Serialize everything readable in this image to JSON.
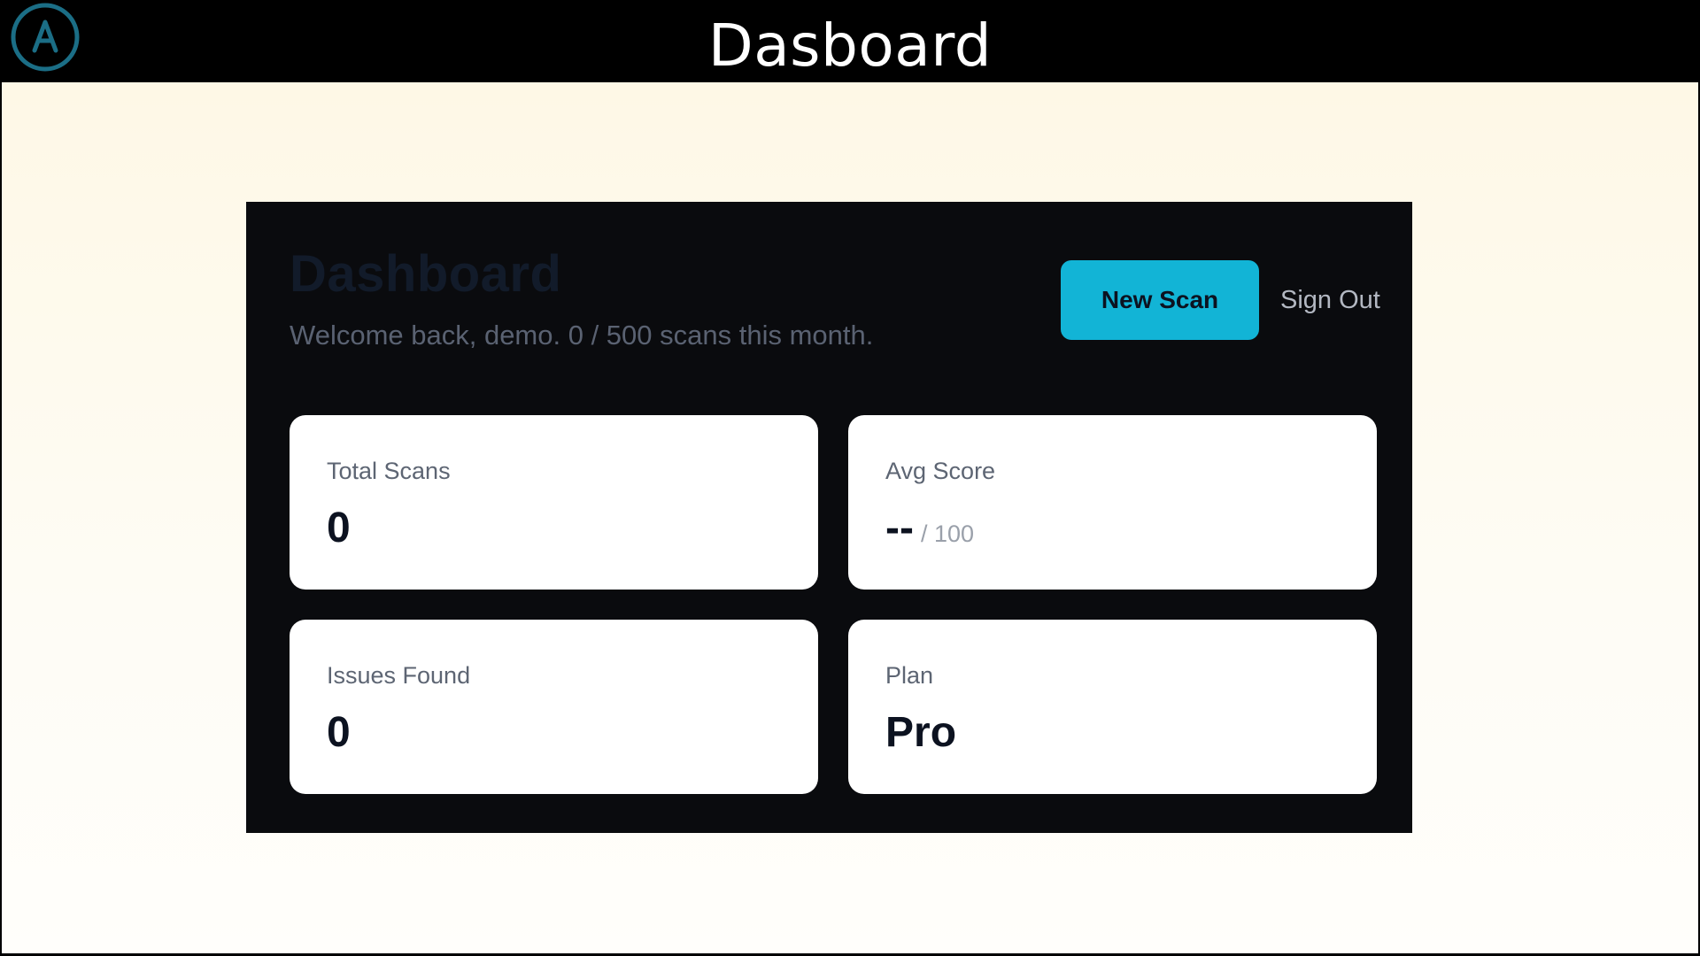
{
  "window": {
    "title": "Dasboard"
  },
  "dashboard": {
    "heading": "Dashboard",
    "subtitle": "Welcome back, demo. 0 / 500 scans this month.",
    "new_scan_label": "New Scan",
    "sign_out_label": "Sign Out"
  },
  "stats": {
    "total_scans": {
      "label": "Total Scans",
      "value": "0"
    },
    "avg_score": {
      "label": "Avg Score",
      "value": "--",
      "suffix": "/ 100"
    },
    "issues_found": {
      "label": "Issues Found",
      "value": "0"
    },
    "plan": {
      "label": "Plan",
      "value": "Pro"
    }
  },
  "colors": {
    "accent": "#12b4d6",
    "panel_bg": "#0a0b0e",
    "page_bg": "#fef8e6",
    "logo_ring": "#1b6e86"
  },
  "icons": {
    "logo": "circle-a-logo-icon"
  }
}
